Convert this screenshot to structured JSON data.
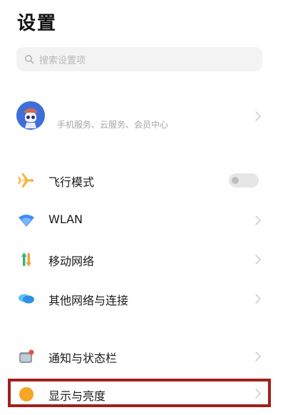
{
  "header": {
    "title": "设置"
  },
  "search": {
    "placeholder": "搜索设置项"
  },
  "account": {
    "subtitle": "手机服务、云服务、会员中心"
  },
  "settings": [
    {
      "label": "飞行模式",
      "icon": "airplane-icon",
      "control": "toggle",
      "toggle_state": "off"
    },
    {
      "label": "WLAN",
      "icon": "wifi-icon",
      "control": "chevron"
    },
    {
      "label": "移动网络",
      "icon": "mobile-network-icon",
      "control": "chevron"
    },
    {
      "label": "其他网络与连接",
      "icon": "connection-icon",
      "control": "chevron"
    },
    {
      "label": "通知与状态栏",
      "icon": "notification-icon",
      "control": "chevron"
    },
    {
      "label": "显示与亮度",
      "icon": "brightness-icon",
      "control": "chevron",
      "highlighted": true
    }
  ],
  "colors": {
    "highlight_border": "#a21f1a",
    "airplane": "#f5b64a",
    "wifi": "#3f8ef5",
    "mobile_up": "#36b37e",
    "mobile_down": "#f0a23a",
    "connection": "#3aa6f0",
    "brightness": "#f5a623"
  }
}
